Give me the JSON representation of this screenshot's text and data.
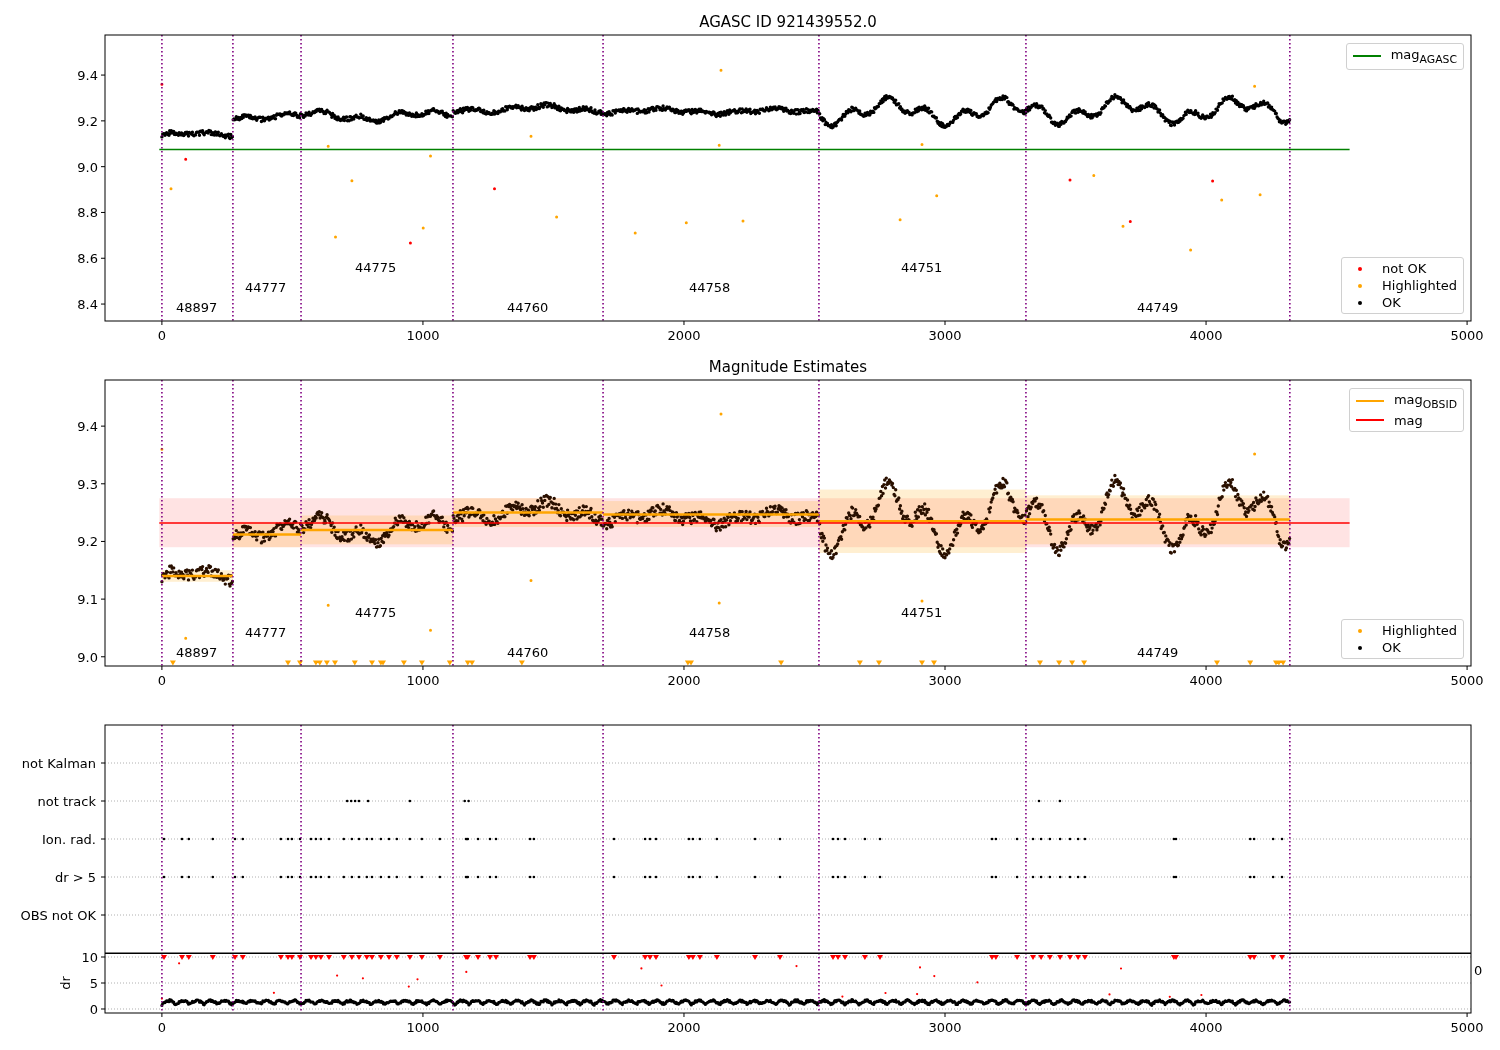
{
  "panels": [
    {
      "chart_data": {
        "type": "line",
        "title": "AGASC ID 921439552.0",
        "xlim": [
          -218,
          5015
        ],
        "ylim": [
          8.326,
          9.575
        ],
        "xticks": [
          0,
          1000,
          2000,
          3000,
          4000,
          5000
        ],
        "yticks": [
          {
            "value": 8.4,
            "label": "8.4"
          },
          {
            "value": 8.6,
            "label": "8.6"
          },
          {
            "value": 8.8,
            "label": "8.8"
          },
          {
            "value": 9.0,
            "label": "9.0"
          },
          {
            "value": 9.2,
            "label": "9.2"
          },
          {
            "value": 9.4,
            "label": "9.4"
          }
        ],
        "series": [
          {
            "name": "mag$_{AGASC}$",
            "type": "line",
            "color": "#008000",
            "x": [
              -10,
              4550
            ],
            "values": [
              9.075,
              9.075
            ]
          }
        ],
        "ref_lines": [
          {
            "axis": "x",
            "value": 0
          },
          {
            "axis": "x",
            "value": 272
          },
          {
            "axis": "x",
            "value": 533
          },
          {
            "axis": "x",
            "value": 1115
          },
          {
            "axis": "x",
            "value": 1690
          },
          {
            "axis": "x",
            "value": 2517
          },
          {
            "axis": "x",
            "value": 3310
          },
          {
            "axis": "x",
            "value": 4321
          }
        ],
        "annotations": [
          "48897",
          "44777",
          "44775",
          "44760",
          "44758",
          "44751",
          "44749"
        ],
        "legend": true
      },
      "markers": [
        {
          "label": "not OK",
          "color": "#ff0000"
        },
        {
          "label": "Highlighted",
          "color": "#ffa500"
        },
        {
          "label": "OK",
          "color": "#000000"
        }
      ]
    },
    {
      "chart_data": {
        "type": "line",
        "title": "Magnitude Estimates",
        "xlim": [
          -218,
          5015
        ],
        "ylim": [
          8.984,
          9.48
        ],
        "xticks": [
          0,
          1000,
          2000,
          3000,
          4000,
          5000
        ],
        "yticks": [
          {
            "value": 9.0,
            "label": "9.0"
          },
          {
            "value": 9.1,
            "label": "9.1"
          },
          {
            "value": 9.2,
            "label": "9.2"
          },
          {
            "value": 9.3,
            "label": "9.3"
          },
          {
            "value": 9.4,
            "label": "9.4"
          }
        ],
        "series": [
          {
            "name": "mag$_{OBSID}$",
            "type": "line",
            "color": "#ffa500",
            "x": [
              0,
              272,
              null,
              272,
              533,
              null,
              533,
              1115,
              null,
              1115,
              1690,
              null,
              1690,
              2517,
              null,
              2517,
              3310,
              null,
              3310,
              4321
            ],
            "values": [
              9.14,
              9.14,
              null,
              9.212,
              9.212,
              null,
              9.22,
              9.22,
              null,
              9.25,
              9.25,
              null,
              9.247,
              9.247,
              null,
              9.235,
              9.235,
              null,
              9.238,
              9.238
            ]
          },
          {
            "name": "mag",
            "type": "line",
            "color": "#ff0000",
            "x": [
              -10,
              4550
            ],
            "values": [
              9.232,
              9.232
            ]
          },
          {
            "type": "scatter",
            "color": "#ffa500",
            "x": [
              42,
              483,
              529,
              590,
              605,
              632,
              663,
              739,
              805,
              839,
              847,
              927,
              996,
              1103,
              1172,
              1188,
              1379,
              2015,
              2027,
              2372,
              2674,
              2747,
              2912,
              2958,
              3364,
              3437,
              3487,
              3533,
              4042,
              4169,
              4268,
              4279,
              4295
            ],
            "values": [
              8.99,
              8.99,
              8.99,
              8.99,
              8.99,
              8.99,
              8.99,
              8.99,
              8.99,
              8.99,
              8.99,
              8.99,
              8.99,
              8.99,
              8.99,
              8.99,
              8.99,
              8.99,
              8.99,
              8.99,
              8.99,
              8.99,
              8.99,
              8.99,
              8.99,
              8.99,
              8.99,
              8.99,
              8.99,
              8.99,
              8.99,
              8.99,
              8.99
            ]
          }
        ],
        "bands": [
          {
            "axis": "y",
            "from": 9.19,
            "to": 9.275,
            "color": "#ff0000"
          },
          {
            "axis": "y",
            "from": 9.13,
            "to": 9.15,
            "color": "#ffa500"
          },
          {
            "axis": "y",
            "from": 9.19,
            "to": 9.234,
            "color": "#ffa500"
          },
          {
            "axis": "y",
            "from": 9.195,
            "to": 9.245,
            "color": "#ffa500"
          },
          {
            "axis": "y",
            "from": 9.225,
            "to": 9.275,
            "color": "#ffa500"
          },
          {
            "axis": "y",
            "from": 9.225,
            "to": 9.27,
            "color": "#ffa500"
          },
          {
            "axis": "y",
            "from": 9.18,
            "to": 9.29,
            "color": "#ffa500"
          },
          {
            "axis": "y",
            "from": 9.195,
            "to": 9.28,
            "color": "#ffa500"
          }
        ],
        "ref_lines": [
          {
            "axis": "x",
            "value": 0
          },
          {
            "axis": "x",
            "value": 272
          },
          {
            "axis": "x",
            "value": 533
          },
          {
            "axis": "x",
            "value": 1115
          },
          {
            "axis": "x",
            "value": 1690
          },
          {
            "axis": "x",
            "value": 2517
          },
          {
            "axis": "x",
            "value": 3310
          },
          {
            "axis": "x",
            "value": 4321
          }
        ],
        "annotations": [
          "48897",
          "44777",
          "44775",
          "44760",
          "44758",
          "44751",
          "44749"
        ],
        "legend": true
      },
      "markers": [
        {
          "label": "Highlighted",
          "color": "#ffa500"
        },
        {
          "label": "OK",
          "color": "#000000"
        }
      ]
    },
    {
      "chart_data": {
        "type": "scatter",
        "orientation": "horizontal",
        "grid": true,
        "xlim": [
          -218,
          5015
        ],
        "categories": [
          "not Kalman",
          "not track",
          "Ion. rad.",
          "dr > 5",
          "OBS not OK"
        ],
        "ref_lines": [
          {
            "axis": "x",
            "value": 0
          },
          {
            "axis": "x",
            "value": 272
          },
          {
            "axis": "x",
            "value": 533
          },
          {
            "axis": "x",
            "value": 1115
          },
          {
            "axis": "x",
            "value": 1690
          },
          {
            "axis": "x",
            "value": 2517
          },
          {
            "axis": "x",
            "value": 3310
          },
          {
            "axis": "x",
            "value": 4321
          }
        ]
      }
    },
    {
      "chart_data": {
        "type": "scatter",
        "ylabel": "dr",
        "grid": true,
        "xlim": [
          -218,
          5015
        ],
        "ylim": [
          -0.77,
          10.77
        ],
        "xticks": [
          0,
          1000,
          2000,
          3000,
          4000,
          5000
        ],
        "yticks": [
          0,
          5,
          10
        ],
        "series": [
          {
            "type": "scatter",
            "color": "#ff0000",
            "x": [
              8,
              77,
              103,
              195,
              280,
              310,
              456,
              483,
              498,
              529,
              571,
              590,
              609,
              640,
              697,
              728,
              755,
              785,
              805,
              839,
              870,
              900,
              950,
              996,
              1065,
              1165,
              1172,
              1211,
              1257,
              1280,
              1410,
              1425,
              1732,
              1851,
              1870,
              1893,
              2019,
              2034,
              2061,
              2126,
              2272,
              2368,
              2571,
              2590,
              2617,
              2693,
              2751,
              3180,
              3195,
              3276,
              3337,
              3368,
              3402,
              3441,
              3479,
              3510,
              3536,
              3877,
              3885,
              4169,
              4184,
              4257,
              4291
            ],
            "values": [
              10,
              10,
              10,
              10,
              10,
              10,
              10,
              10,
              10,
              10,
              10,
              10,
              10,
              10,
              10,
              10,
              10,
              10,
              10,
              10,
              10,
              10,
              10,
              10,
              10,
              10,
              10,
              10,
              10,
              10,
              10,
              10,
              10,
              10,
              10,
              10,
              10,
              10,
              10,
              10,
              10,
              10,
              10,
              10,
              10,
              10,
              10,
              10,
              10,
              10,
              10,
              10,
              10,
              10,
              10,
              10,
              10,
              10,
              10,
              10,
              10,
              10,
              10
            ]
          }
        ],
        "ref_lines": [
          {
            "axis": "x",
            "value": 0
          },
          {
            "axis": "x",
            "value": 272
          },
          {
            "axis": "x",
            "value": 533
          },
          {
            "axis": "x",
            "value": 1115
          },
          {
            "axis": "x",
            "value": 1690
          },
          {
            "axis": "x",
            "value": 2517
          },
          {
            "axis": "x",
            "value": 3310
          },
          {
            "axis": "x",
            "value": 4321
          }
        ]
      },
      "stray_label": "0"
    }
  ]
}
